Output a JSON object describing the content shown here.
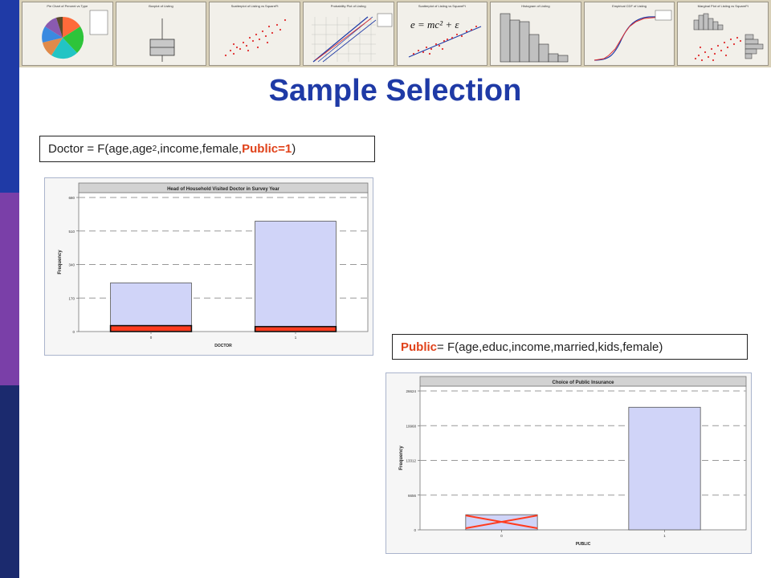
{
  "slide": {
    "title": "Sample Selection",
    "colors": {
      "title": "#1f3aa6",
      "accent_red": "#e0421a",
      "bar_fill": "#d0d4f8",
      "bar_stroke": "#555555",
      "marker_red": "#ff3b1f"
    }
  },
  "banner": {
    "thumbnails": [
      {
        "name": "pie",
        "title": "Pie Chart of Percent vs Type"
      },
      {
        "name": "boxplot",
        "title": "Boxplot of Listing"
      },
      {
        "name": "scatter1",
        "title": "Scatterplot of Listing vs SquareFt"
      },
      {
        "name": "probability",
        "title": "Probability Plot of Listing"
      },
      {
        "name": "scatter2",
        "title": "Scatterplot of Listing vs SquareFt"
      },
      {
        "name": "histogram",
        "title": "Histogram of Listing"
      },
      {
        "name": "ecdf",
        "title": "Empirical CDF of Listing"
      },
      {
        "name": "marginal",
        "title": "Marginal Plot of Listing vs SquareFt"
      }
    ],
    "formula_text": "e = mc² + ε"
  },
  "equations": {
    "eq1": {
      "prefix": "Doctor = F(age,age",
      "sup": "2",
      "middle": ",income,female,",
      "highlight": "Public=1",
      "suffix": ")"
    },
    "eq2": {
      "highlight": "Public",
      "rest": " = F(age,educ,income,married,kids,female)"
    }
  },
  "chart_data": [
    {
      "type": "bar",
      "title": "Head of Household Visited Doctor in Survey Year",
      "xlabel": "DOCTOR",
      "ylabel": "Frequency",
      "categories": [
        "0",
        "1"
      ],
      "values": [
        247,
        560
      ],
      "selected_values": [
        30,
        25
      ],
      "yticks": [
        0,
        170,
        340,
        510,
        680
      ],
      "ylim": [
        0,
        680
      ],
      "grid": "dashed-horizontal"
    },
    {
      "type": "bar",
      "title": "Choice of Public Insurance",
      "xlabel": "PUBLIC",
      "ylabel": "Frequency",
      "categories": [
        "0",
        "1"
      ],
      "values": [
        2900,
        23500
      ],
      "crossed_out": [
        true,
        false
      ],
      "yticks": [
        0,
        6656,
        13312,
        19968,
        26624
      ],
      "ylim": [
        0,
        26624
      ],
      "grid": "dashed-horizontal"
    }
  ]
}
